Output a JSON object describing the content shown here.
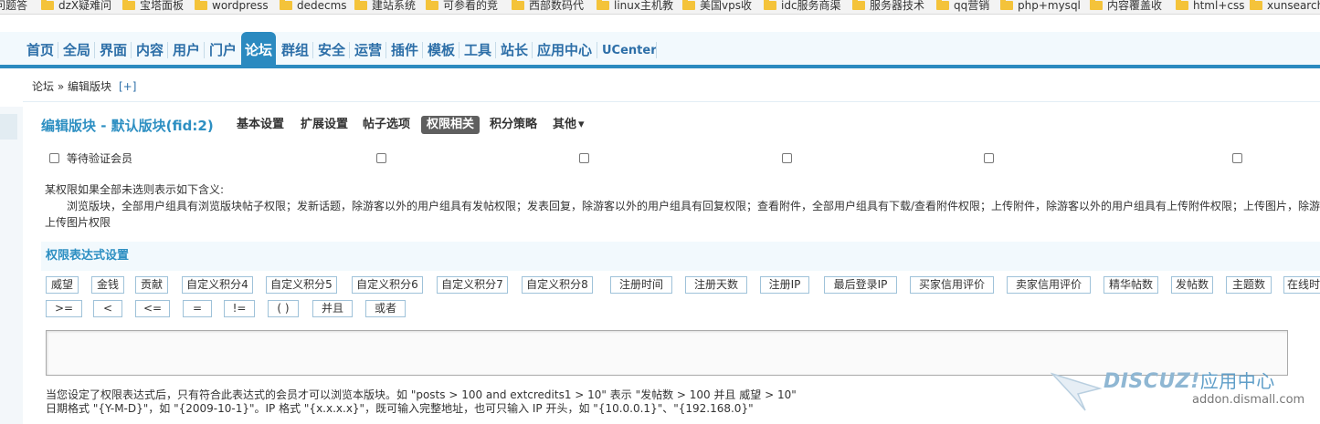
{
  "bookmarks": [
    "问题答",
    "dzX疑难问",
    "宝塔面板",
    "wordpress",
    "dedecms",
    "建站系统",
    "可参看的竞",
    "西部数码代",
    "linux主机教",
    "美国vps收",
    "idc服务商渠",
    "服务器技术",
    "qq营销",
    "php+mysql",
    "内容覆盖收",
    "html+css",
    "xunsearch"
  ],
  "nav": {
    "items": [
      "首页",
      "全局",
      "界面",
      "内容",
      "用户",
      "门户",
      "论坛",
      "群组",
      "安全",
      "运营",
      "插件",
      "模板",
      "工具",
      "站长",
      "应用中心",
      "UCenter"
    ],
    "active": "论坛"
  },
  "breadcrumb": {
    "path": "论坛 » 编辑版块",
    "add": "[+]"
  },
  "page": {
    "title": "编辑版块 - 默认版块(fid:2)",
    "tabs": [
      "基本设置",
      "扩展设置",
      "帖子选项",
      "权限相关",
      "积分策略",
      "其他"
    ],
    "active_tab": "权限相关",
    "other_arrow": "▾"
  },
  "group_row": {
    "first_label": "等待验证会员"
  },
  "notes": {
    "line1": "某权限如果全部未选则表示如下含义:",
    "line2": "浏览版块，全部用户组具有浏览版块帖子权限；发新话题，除游客以外的用户组具有发帖权限；发表回复，除游客以外的用户组具有回复权限；查看附件，全部用户组具有下载/查看附件权限；上传附件，除游客以外的用户组具有上传附件权限；上传图片，除游",
    "line3": "上传图片权限"
  },
  "expr": {
    "heading": "权限表达式设置",
    "vars": [
      "威望",
      "金钱",
      "贡献",
      "自定义积分4",
      "自定义积分5",
      "自定义积分6",
      "自定义积分7",
      "自定义积分8",
      "注册时间",
      "注册天数",
      "注册IP",
      "最后登录IP",
      "买家信用评价",
      "卖家信用评价",
      "精华帖数",
      "发帖数",
      "主题数",
      "在线时"
    ],
    "ops": [
      ">=",
      "<",
      "<=",
      "=",
      "!=",
      "( )",
      "并且",
      "或者"
    ],
    "help1": "当您设定了权限表达式后，只有符合此表达式的会员才可以浏览本版块。如 \"posts > 100 and extcredits1 > 10\" 表示 \"发帖数 > 100 并且 威望 > 10\"",
    "help2": "日期格式 \"{Y-M-D}\"，如 \"{2009-10-1}\"。IP 格式 \"{x.x.x.x}\"，既可输入完整地址，也可只输入 IP 开头，如 \"{10.0.0.1}\"、\"{192.168.0}\""
  },
  "watermark": {
    "brand": "DISCUZ!",
    "suffix": "应用中心",
    "url": "addon.dismall.com"
  },
  "colors": {
    "accent": "#2b8ac0",
    "link": "#2d6fa8",
    "title": "#2d8fc2"
  }
}
